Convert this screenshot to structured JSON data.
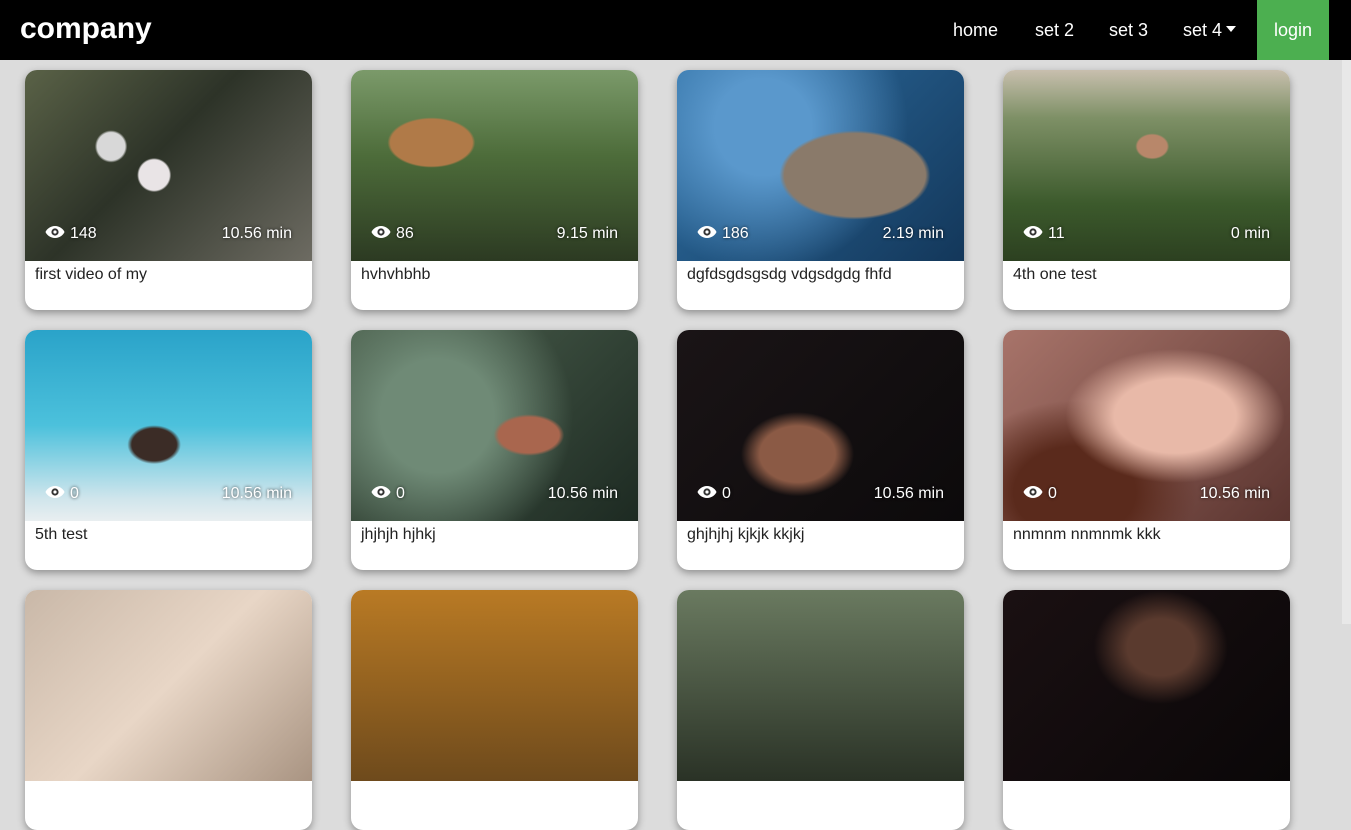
{
  "nav": {
    "brand": "company",
    "links": [
      "home",
      "set 2",
      "set 3",
      "set 4"
    ],
    "login": "login"
  },
  "videos": [
    {
      "views": "148",
      "duration": "10.56 min",
      "title": "first video of my"
    },
    {
      "views": "86",
      "duration": "9.15 min",
      "title": "hvhvhbhb"
    },
    {
      "views": "186",
      "duration": "2.19 min",
      "title": "dgfdsgdsgsdg vdgsdgdg fhfd"
    },
    {
      "views": "11",
      "duration": "0 min",
      "title": "4th one test"
    },
    {
      "views": "0",
      "duration": "10.56 min",
      "title": "5th test"
    },
    {
      "views": "0",
      "duration": "10.56 min",
      "title": "jhjhjh hjhkj"
    },
    {
      "views": "0",
      "duration": "10.56 min",
      "title": "ghjhjhj kjkjk kkjkj"
    },
    {
      "views": "0",
      "duration": "10.56 min",
      "title": "nnmnm nnmnmk kkk"
    }
  ],
  "colors": {
    "navbar": "#000000",
    "login": "#4caf50",
    "page": "#dcdcdc"
  }
}
